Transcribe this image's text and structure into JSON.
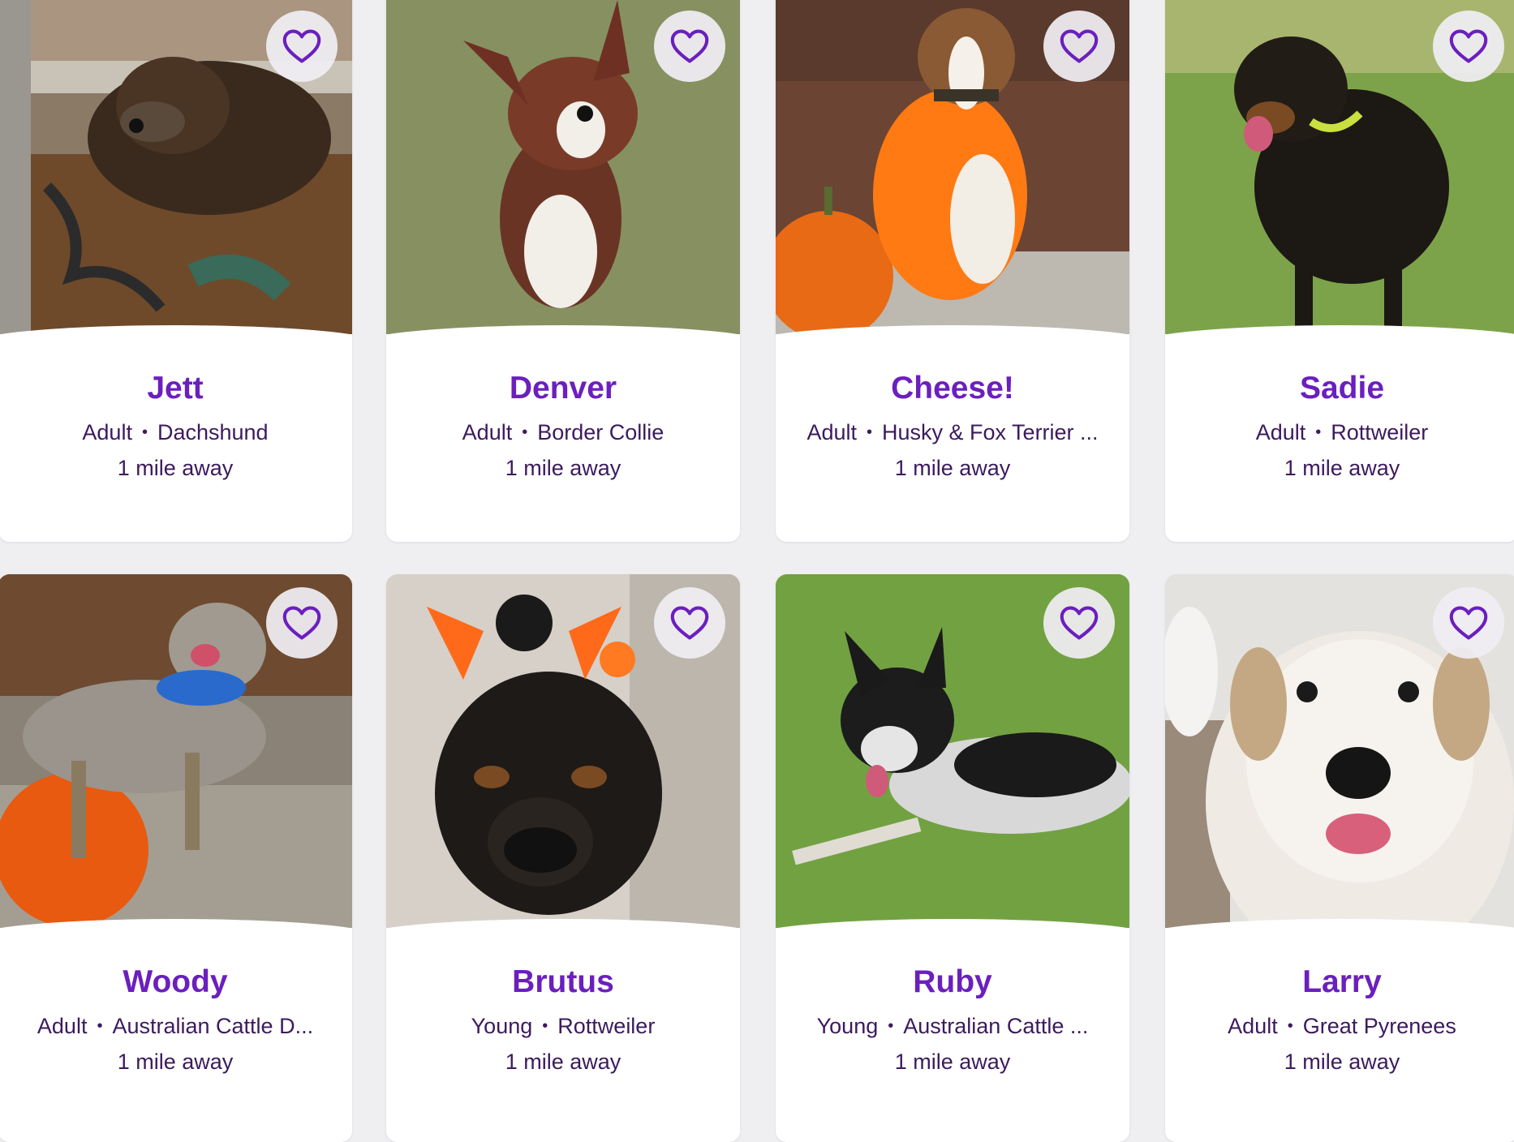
{
  "accent_color": "#6b1fbe",
  "text_color": "#3c1a5e",
  "favorite_icon": "heart-outline-icon",
  "pets": [
    {
      "name": "Jett",
      "age": "Adult",
      "breed": "Dachshund",
      "distance": "1 mile away"
    },
    {
      "name": "Denver",
      "age": "Adult",
      "breed": "Border Collie",
      "distance": "1 mile away"
    },
    {
      "name": "Cheese!",
      "age": "Adult",
      "breed": "Husky & Fox Terrier ...",
      "distance": "1 mile away"
    },
    {
      "name": "Sadie",
      "age": "Adult",
      "breed": "Rottweiler",
      "distance": "1 mile away"
    },
    {
      "name": "Woody",
      "age": "Adult",
      "breed": "Australian Cattle D...",
      "distance": "1 mile away"
    },
    {
      "name": "Brutus",
      "age": "Young",
      "breed": "Rottweiler",
      "distance": "1 mile away"
    },
    {
      "name": "Ruby",
      "age": "Young",
      "breed": "Australian Cattle ...",
      "distance": "1 mile away"
    },
    {
      "name": "Larry",
      "age": "Adult",
      "breed": "Great Pyrenees",
      "distance": "1 mile away"
    }
  ]
}
